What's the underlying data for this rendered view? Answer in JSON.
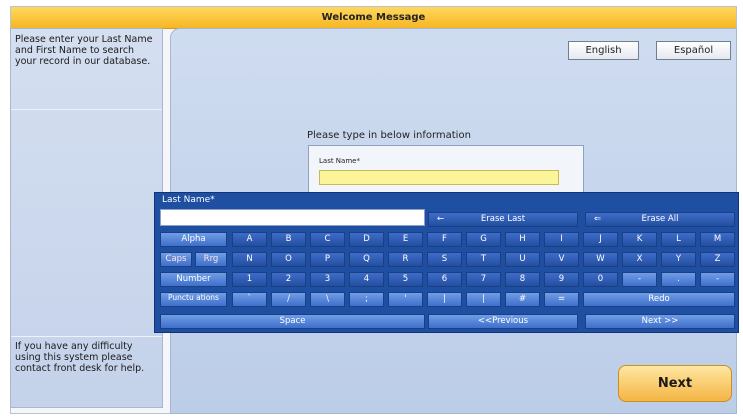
{
  "window": {
    "title": "Welcome Message"
  },
  "sidebar": {
    "instructions": "Please enter your  Last Name and First Name to search your record in our database.",
    "help": "If you have any difficulty using this system please contact front desk for help."
  },
  "language": {
    "english": "English",
    "espanol": "Español"
  },
  "form": {
    "prompt": "Please type in below information",
    "last_name_label": "Last Name*",
    "last_name_value": ""
  },
  "keyboard": {
    "title": "Last Name*",
    "erase_last": "Erase Last",
    "erase_all": "Erase All",
    "mode_labels": [
      "Alpha",
      "Caps",
      "Rrg",
      "Number",
      "Punctu ations"
    ],
    "row1": [
      "A",
      "B",
      "C",
      "D",
      "E",
      "F",
      "G",
      "H",
      "I",
      "J",
      "K",
      "L",
      "M"
    ],
    "row2": [
      "N",
      "O",
      "P",
      "Q",
      "R",
      "S",
      "T",
      "U",
      "V",
      "W",
      "X",
      "Y",
      "Z"
    ],
    "row3": [
      "1",
      "2",
      "3",
      "4",
      "5",
      "6",
      "7",
      "8",
      "9",
      "0",
      "-",
      ".",
      "-"
    ],
    "row4": [
      "`",
      "/",
      "\\",
      ";",
      "'",
      "|",
      "|",
      "#",
      "="
    ],
    "redo": "Redo",
    "space": "Space",
    "previous": "<<Previous",
    "next": "Next >>"
  },
  "footer": {
    "next": "Next"
  }
}
